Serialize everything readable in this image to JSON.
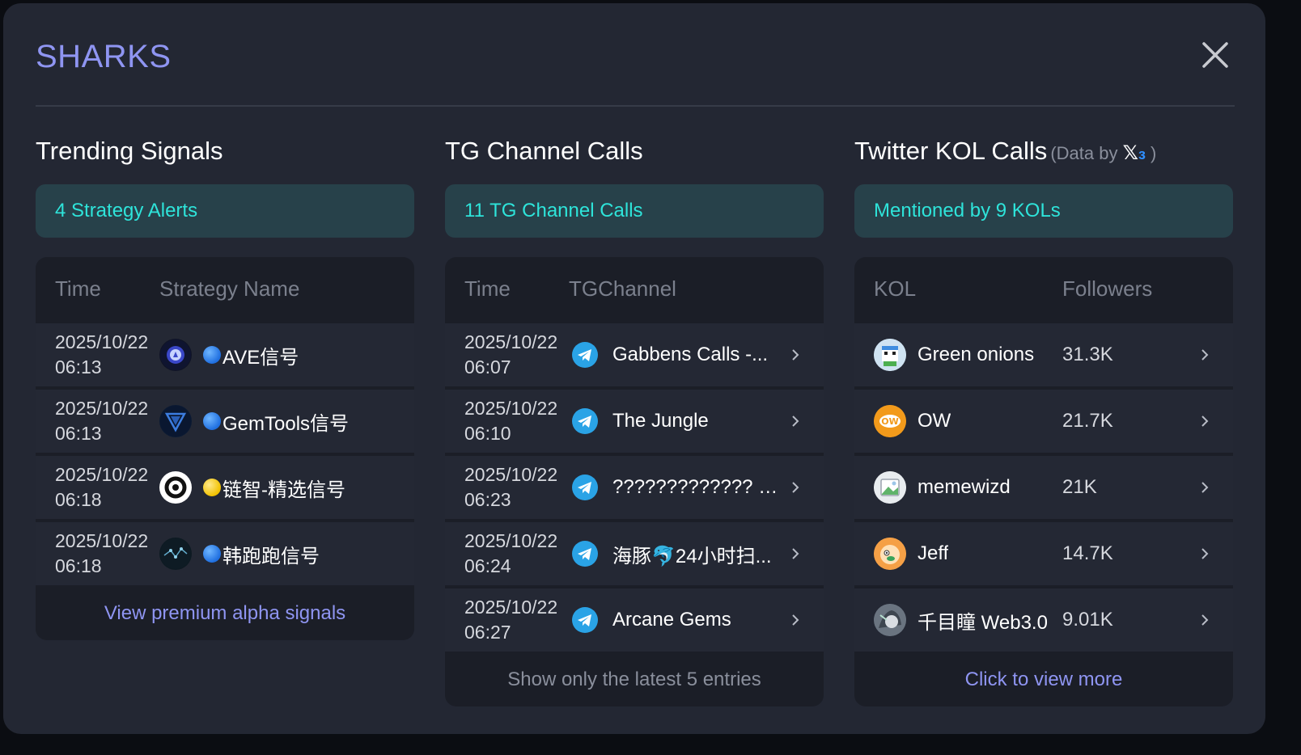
{
  "modal": {
    "title": "SHARKS"
  },
  "trending": {
    "title": "Trending Signals",
    "banner": "4 Strategy Alerts",
    "headers": {
      "time": "Time",
      "name": "Strategy Name"
    },
    "rows": [
      {
        "date": "2025/10/22",
        "time": "06:13",
        "dot": "blue",
        "name": "AVE信号",
        "icon": "ave-logo-icon"
      },
      {
        "date": "2025/10/22",
        "time": "06:13",
        "dot": "blue",
        "name": "GemTools信号",
        "icon": "gemtools-logo-icon"
      },
      {
        "date": "2025/10/22",
        "time": "06:18",
        "dot": "yellow",
        "name": "链智-精选信号",
        "icon": "chain-logo-icon"
      },
      {
        "date": "2025/10/22",
        "time": "06:18",
        "dot": "blue",
        "name": "韩跑跑信号",
        "icon": "network-logo-icon"
      }
    ],
    "footer": "View premium alpha signals"
  },
  "tg": {
    "title": "TG Channel Calls",
    "banner": "11 TG Channel Calls",
    "headers": {
      "time": "Time",
      "name": "TGChannel"
    },
    "rows": [
      {
        "date": "2025/10/22",
        "time": "06:07",
        "name": "Gabbens Calls -..."
      },
      {
        "date": "2025/10/22",
        "time": "06:10",
        "name": "The Jungle"
      },
      {
        "date": "2025/10/22",
        "time": "06:23",
        "name": "????????????? - ..."
      },
      {
        "date": "2025/10/22",
        "time": "06:24",
        "name": "海豚🐬24小时扫..."
      },
      {
        "date": "2025/10/22",
        "time": "06:27",
        "name": "Arcane Gems"
      }
    ],
    "footer": "Show only the latest 5 entries"
  },
  "kol": {
    "title": "Twitter KOL Calls",
    "data_by": "(Data by",
    "data_by_close": ")",
    "banner": "Mentioned by 9 KOLs",
    "headers": {
      "kol": "KOL",
      "followers": "Followers"
    },
    "rows": [
      {
        "name": "Green onions",
        "followers": "31.3K",
        "icon": "pixel-avatar-icon"
      },
      {
        "name": "OW",
        "followers": "21.7K",
        "icon": "ow-avatar-icon"
      },
      {
        "name": "memewizd",
        "followers": "21K",
        "icon": "landscape-avatar-icon"
      },
      {
        "name": "Jeff",
        "followers": "14.7K",
        "icon": "cartoon-avatar-icon"
      },
      {
        "name": "千目瞳 Web3.0",
        "followers": "9.01K",
        "icon": "anime-avatar-icon"
      }
    ],
    "footer": "Click to view more"
  },
  "colors": {
    "title": "#8f95f2",
    "banner_text": "#2ee4da",
    "banner_bg": "#27414a",
    "panel": "#232733",
    "telegram": "#2aa3e6",
    "link": "#8f95f2"
  }
}
